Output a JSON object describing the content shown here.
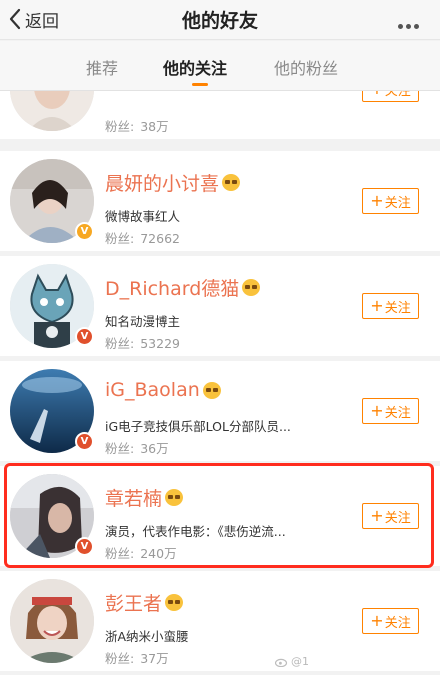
{
  "header": {
    "back_label": "返回",
    "title": "他的好友"
  },
  "tabs": [
    {
      "label": "推荐",
      "active": false
    },
    {
      "label": "他的关注",
      "active": true
    },
    {
      "label": "他的粉丝",
      "active": false
    }
  ],
  "colors": {
    "accent": "#ff8200",
    "name": "#eb7350",
    "highlight": "#ff2d1e",
    "badge_yellow": "#f7a823",
    "badge_red": "#e0502c"
  },
  "users": [
    {
      "name": "",
      "description": "",
      "fans_label": "粉丝:",
      "fans": "38万",
      "follow_label": "关注",
      "badge": "none"
    },
    {
      "name": "晨妍的小讨喜",
      "description": "微博故事红人",
      "fans_label": "粉丝:",
      "fans": "72662",
      "follow_label": "关注",
      "badge": "yellow-v"
    },
    {
      "name": "D_Richard德猫",
      "description": "知名动漫博主",
      "fans_label": "粉丝:",
      "fans": "53229",
      "follow_label": "关注",
      "badge": "red-v"
    },
    {
      "name": "iG_Baolan",
      "description": "iG电子竞技俱乐部LOL分部队员...",
      "fans_label": "粉丝:",
      "fans": "36万",
      "follow_label": "关注",
      "badge": "red-v"
    },
    {
      "name": "章若楠",
      "description": "演员，代表作电影：《悲伤逆流...",
      "fans_label": "粉丝:",
      "fans": "240万",
      "follow_label": "关注",
      "badge": "red-v",
      "highlighted": true
    },
    {
      "name": "彭王者",
      "description": "浙A纳米小蛮腰",
      "fans_label": "粉丝:",
      "fans": "37万",
      "follow_label": "关注",
      "badge": "none"
    }
  ],
  "watermark": "@1"
}
